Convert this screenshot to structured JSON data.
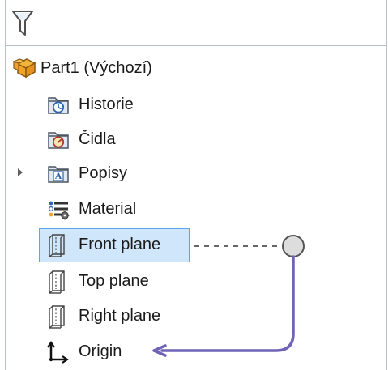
{
  "filter": {
    "icon": "filter-funnel-icon"
  },
  "tree": {
    "root": {
      "label": "Part1  (Výchozí)",
      "icon": "part-icon"
    },
    "items": [
      {
        "label": "Historie",
        "icon": "history-folder-icon"
      },
      {
        "label": "Čidla",
        "icon": "sensors-folder-icon"
      },
      {
        "label": "Popisy",
        "icon": "annotations-folder-icon"
      },
      {
        "label": "Material",
        "icon": "material-icon"
      },
      {
        "label": "Front plane",
        "icon": "plane-icon"
      },
      {
        "label": "Top plane",
        "icon": "plane-icon"
      },
      {
        "label": "Right plane",
        "icon": "plane-icon"
      },
      {
        "label": "Origin",
        "icon": "origin-icon"
      }
    ],
    "selected": "Front plane"
  },
  "colors": {
    "panel_border": "#b9c0c8",
    "selection_fill": "#cfe6fb",
    "selection_border": "#5aa6ea",
    "annotation_line": "#6f63b6",
    "dashed_line": "#666666"
  }
}
